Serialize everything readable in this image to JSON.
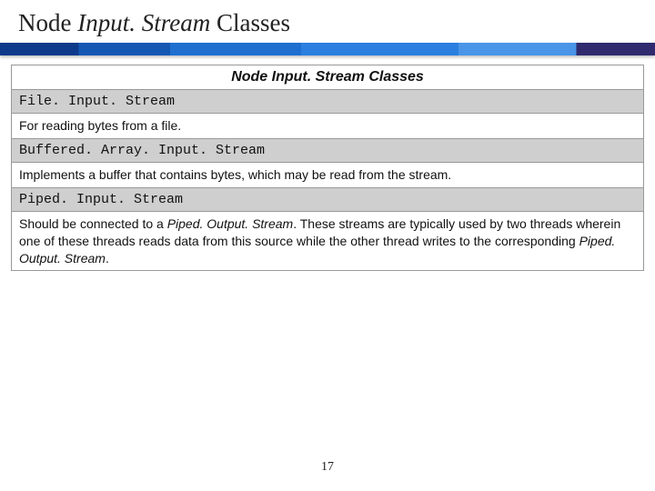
{
  "slide": {
    "title_pre": "Node ",
    "title_it": "Input. Stream",
    "title_post": " Classes",
    "page_number": "17"
  },
  "table": {
    "header": "Node Input. Stream Classes",
    "rows": [
      {
        "class": "File. Input. Stream",
        "desc_plain": "For reading bytes from a file."
      },
      {
        "class": "Buffered. Array. Input. Stream",
        "desc_plain": "Implements a buffer that contains bytes, which may be read from the stream."
      },
      {
        "class": "Piped. Input. Stream",
        "desc_parts": {
          "a": "Should be connected to a ",
          "b": "Piped. Output. Stream",
          "c": ". These streams are typically used by two threads wherein one of these threads reads data from this source while the other thread writes to the corresponding ",
          "d": "Piped. Output. Stream",
          "e": "."
        }
      }
    ]
  }
}
